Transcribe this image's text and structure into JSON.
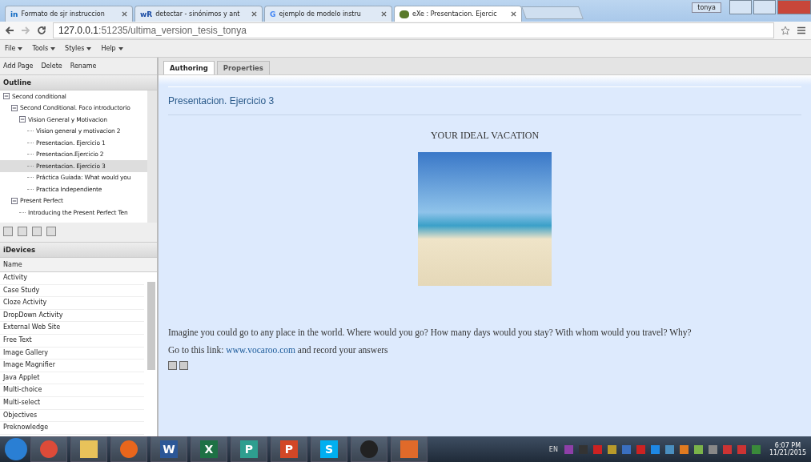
{
  "browser": {
    "tabs": [
      {
        "icon_text": "in",
        "title": "Formato de sjr instruccion",
        "selected": false
      },
      {
        "icon_text": "wR",
        "title": "detectar - sinónimos y ant",
        "selected": false
      },
      {
        "icon_text": "G",
        "title": "ejemplo de modelo instru",
        "selected": false
      },
      {
        "title": "eXe : Presentacion. Ejercic",
        "selected": true
      }
    ],
    "user": "tonya",
    "url_host": "127.0.0.1",
    "url_rest": ":51235/ultima_version_tesis_tonya"
  },
  "menu": [
    "File",
    "Tools",
    "Styles",
    "Help"
  ],
  "outline_actions": [
    "Add Page",
    "Delete",
    "Rename"
  ],
  "outline": {
    "title": "Outline",
    "tree": [
      {
        "label": "Second conditional",
        "expanded": true,
        "selected": false,
        "children": [
          {
            "label": "Second Conditional. Foco introductorio",
            "expanded": true,
            "selected": false,
            "children": [
              {
                "label": "Vision General y Motivacion",
                "expanded": true,
                "selected": false,
                "children": [
                  {
                    "label": "Vision general y motivacion 2",
                    "selected": false
                  },
                  {
                    "label": "Presentacion. Ejercicio 1",
                    "selected": false
                  },
                  {
                    "label": "Presentacion.Ejercicio 2",
                    "selected": false
                  },
                  {
                    "label": "Presentacion. Ejercicio 3",
                    "selected": true
                  },
                  {
                    "label": "Práctica Guiada: What would you",
                    "selected": false
                  },
                  {
                    "label": "Practica Independiente",
                    "selected": false
                  }
                ]
              }
            ]
          },
          {
            "label": "Present Perfect",
            "expanded": true,
            "selected": false,
            "children": [
              {
                "label": "Introducing the Present Perfect Ten",
                "selected": false
              }
            ]
          }
        ]
      }
    ]
  },
  "idevices": {
    "title": "iDevices",
    "column": "Name",
    "items": [
      "Activity",
      "Case Study",
      "Cloze Activity",
      "DropDown Activity",
      "External Web Site",
      "Free Text",
      "Image Gallery",
      "Image Magnifier",
      "Java Applet",
      "Multi-choice",
      "Multi-select",
      "Objectives",
      "Preknowledge"
    ]
  },
  "content_tabs": [
    {
      "label": "Authoring",
      "selected": true
    },
    {
      "label": "Properties",
      "selected": false
    }
  ],
  "page": {
    "title": "Presentacion. Ejercicio 3",
    "heading": "YOUR IDEAL VACATION",
    "question": "Imagine you could go to any place in the world. Where would you go?  How many days would you stay? With whom would you travel? Why?",
    "link_before": "Go to this link: ",
    "link": "www.vocaroo.com",
    "link_after": " and record your answers"
  },
  "taskbar": {
    "apps": [
      {
        "kind": "start"
      },
      {
        "kind": "chrome"
      },
      {
        "kind": "folder"
      },
      {
        "kind": "firefox"
      },
      {
        "kind": "word",
        "text": "W"
      },
      {
        "kind": "excel",
        "text": "X"
      },
      {
        "kind": "publisher",
        "text": "P"
      },
      {
        "kind": "powerpoint",
        "text": "P"
      },
      {
        "kind": "skype",
        "text": "S"
      },
      {
        "kind": "camera"
      },
      {
        "kind": "photos"
      }
    ],
    "lang": "EN",
    "time": "6:07 PM",
    "date": "11/21/2015"
  }
}
